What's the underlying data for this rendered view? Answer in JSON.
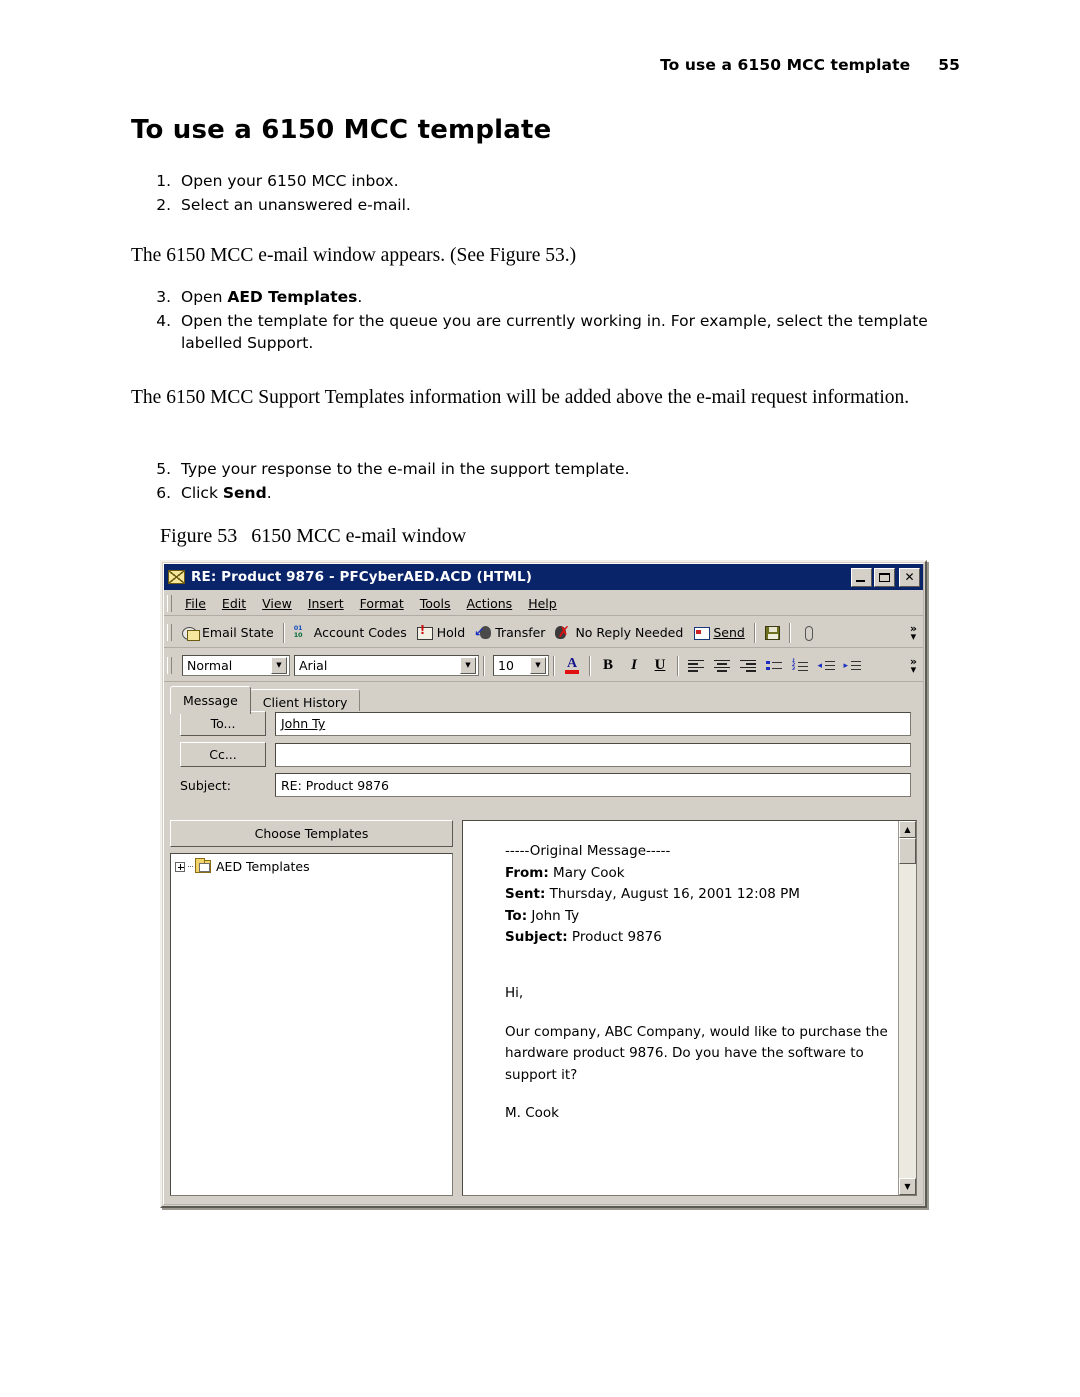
{
  "page": {
    "header_title": "To use a 6150 MCC template",
    "page_number": "55",
    "heading": "To use a 6150 MCC template"
  },
  "steps_1": [
    {
      "num": "1.",
      "text": "Open your 6150 MCC inbox."
    },
    {
      "num": "2.",
      "text": "Select an unanswered e-mail."
    }
  ],
  "para_1": "The 6150 MCC e-mail window appears. (See Figure 53.)",
  "steps_2": [
    {
      "num": "3.",
      "pre": "Open ",
      "bold": "AED Templates",
      "post": "."
    },
    {
      "num": "4.",
      "pre": "Open the template for the queue you are currently working in. For example, select the template labelled Support.",
      "bold": "",
      "post": ""
    }
  ],
  "para_2": "The 6150 MCC Support Templates information will be added above the e-mail request information.",
  "steps_3": [
    {
      "num": "5.",
      "pre": "Type your response to the e-mail in the support template.",
      "bold": "",
      "post": ""
    },
    {
      "num": "6.",
      "pre": "Click ",
      "bold": "Send",
      "post": "."
    }
  ],
  "figure": {
    "label": "Figure 53",
    "caption": "6150 MCC e-mail window"
  },
  "window": {
    "title": "RE: Product 9876 - PFCyberAED.ACD (HTML)",
    "icon": "envelope-icon",
    "buttons": {
      "minimize": "minimize",
      "maximize": "maximize",
      "close": "close"
    },
    "menu": [
      "File",
      "Edit",
      "View",
      "Insert",
      "Format",
      "Tools",
      "Actions",
      "Help"
    ],
    "toolbar": [
      {
        "label": "Email State",
        "icon": "email-state-icon"
      },
      {
        "label": "Account Codes",
        "icon": "account-codes-icon"
      },
      {
        "label": "Hold",
        "icon": "hold-icon"
      },
      {
        "label": "Transfer",
        "icon": "transfer-icon"
      },
      {
        "label": "No Reply Needed",
        "icon": "no-reply-needed-icon"
      },
      {
        "label": "Send",
        "icon": "send-icon"
      },
      {
        "label": "",
        "icon": "save-icon"
      },
      {
        "label": "",
        "icon": "attach-icon"
      }
    ],
    "toolbar_overflow": "»",
    "format_toolbar": {
      "style": "Normal",
      "font": "Arial",
      "size": "10",
      "bold": "B",
      "italic": "I",
      "underline": "U",
      "overflow": "»"
    },
    "tabs": [
      {
        "label": "Message",
        "active": true
      },
      {
        "label": "Client History",
        "active": false
      }
    ],
    "form": {
      "to_button": "To...",
      "to_value": "John Ty",
      "cc_button": "Cc...",
      "cc_value": "",
      "subject_label": "Subject:",
      "subject_value": "RE: Product 9876"
    },
    "templates": {
      "choose_button": "Choose Templates",
      "tree_root": "AED Templates"
    },
    "message": {
      "separator": "-----Original Message-----",
      "from_label": "From:",
      "from_value": " Mary Cook",
      "sent_label": "Sent:",
      "sent_value": " Thursday, August 16, 2001 12:08 PM",
      "to_label": "To:",
      "to_value": " John Ty",
      "subject_label": "Subject:",
      "subject_value": " Product 9876",
      "greeting": "Hi,",
      "body": "Our company, ABC Company, would like to purchase the hardware product 9876. Do you have the software to support it?",
      "signature": "M. Cook"
    }
  },
  "colors": {
    "titlebar": "#0a246a",
    "window_face": "#d4d0c8",
    "accent_red": "#e01010"
  }
}
